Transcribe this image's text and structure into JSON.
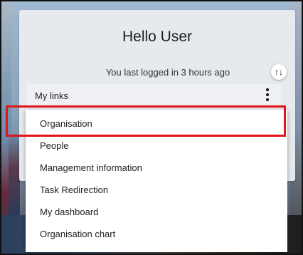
{
  "welcome": {
    "greeting": "Hello User",
    "last_login": "You last logged in 3 hours ago",
    "sort_icon": "↑↓"
  },
  "links": {
    "label": "My links"
  },
  "menu": {
    "items": [
      {
        "label": "Organisation"
      },
      {
        "label": "People"
      },
      {
        "label": "Management information"
      },
      {
        "label": "Task Redirection"
      },
      {
        "label": "My dashboard"
      },
      {
        "label": "Organisation chart"
      }
    ]
  },
  "highlight": {
    "color": "#e1151a"
  }
}
